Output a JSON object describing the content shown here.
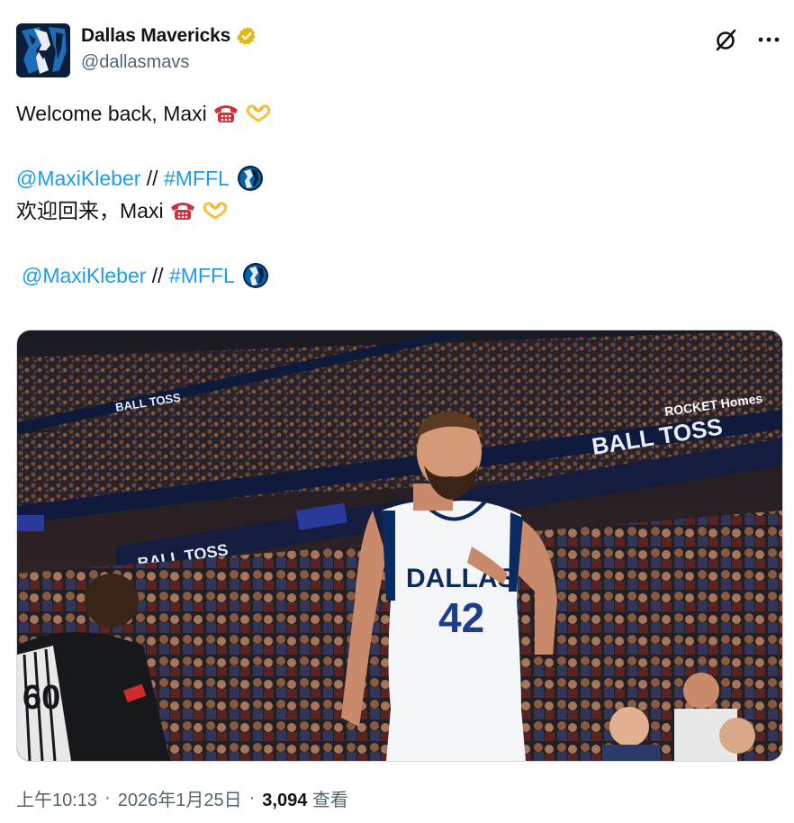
{
  "account": {
    "display_name": "Dallas Mavericks",
    "handle": "@dallasmavs",
    "verified_badge_icon": "gold-verified-badge-icon",
    "avatar_icon": "mavericks-horse-logo"
  },
  "actions": {
    "grok_icon": "grok-slash-circle-icon",
    "more_icon": "more-horizontal-icon"
  },
  "tweet": {
    "line1_text": "Welcome back, Maxi",
    "line2_mention": "@MaxiKleber",
    "line2_sep": " // ",
    "line2_hashtag": "#MFFL",
    "line3_text": "欢迎回来，Maxi",
    "line4_mention": "@MaxiKleber",
    "line4_sep": " // ",
    "line4_hashtag": "#MFFL",
    "emoji_phone": "red-telephone-emoji",
    "emoji_heart_hands": "heart-hands-emoji",
    "hashflag_icon": "mavs-hashflag-icon"
  },
  "media": {
    "jersey_team": "DALLAS",
    "jersey_number": "42",
    "ref_number": "60",
    "banner_text": "BALL TOSS",
    "sponsor_text": "ROCKET Homes"
  },
  "meta": {
    "time": "上午10:13",
    "dot1": "·",
    "date": "2026年1月25日",
    "dot2": "·",
    "views_count": "3,094",
    "views_label": "查看"
  },
  "colors": {
    "link": "#1d9bf0",
    "secondary_text": "#536471",
    "primary_text": "#0f1419",
    "mavs_blue": "#0064b1",
    "mavs_navy": "#002b5e"
  }
}
